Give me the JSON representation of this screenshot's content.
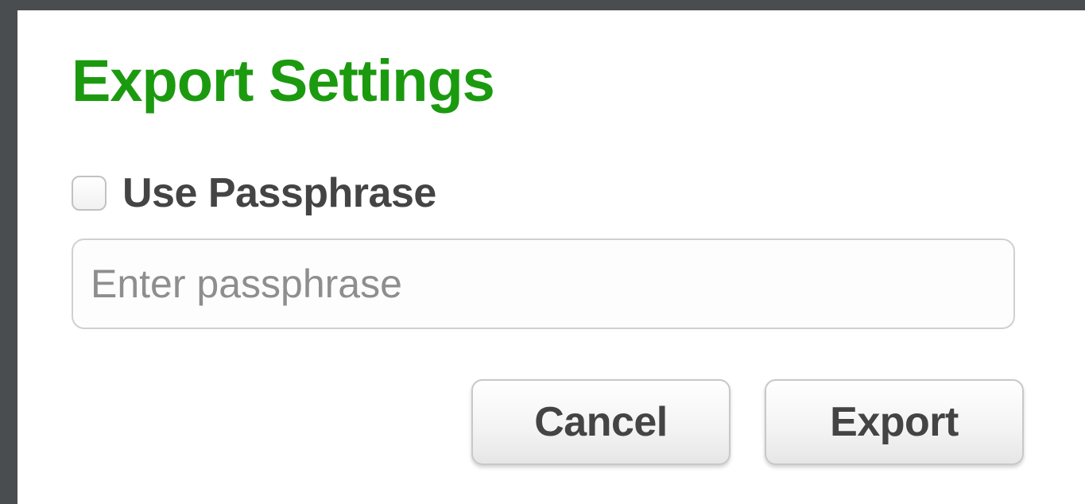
{
  "dialog": {
    "title": "Export Settings",
    "title_color": "#1b9a0f",
    "use_passphrase": {
      "label": "Use Passphrase",
      "checked": false
    },
    "passphrase_field": {
      "placeholder": "Enter passphrase",
      "value": ""
    },
    "buttons": {
      "cancel_label": "Cancel",
      "export_label": "Export"
    }
  }
}
